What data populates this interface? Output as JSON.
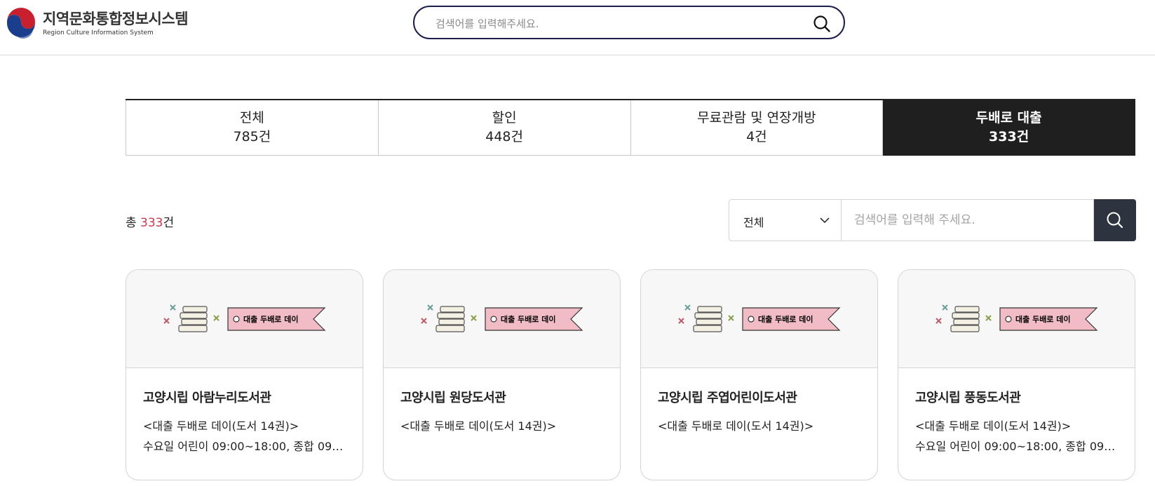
{
  "header": {
    "logo_title": "지역문화통합정보시스템",
    "logo_sub": "Region Culture Information System",
    "search_placeholder": "검색어를 입력해주세요."
  },
  "tabs": [
    {
      "label": "전체",
      "count": "785건",
      "active": false
    },
    {
      "label": "할인",
      "count": "448건",
      "active": false
    },
    {
      "label": "무료관람 및 연장개방",
      "count": "4건",
      "active": false
    },
    {
      "label": "두배로 대출",
      "count": "333건",
      "active": true
    }
  ],
  "results": {
    "prefix": "총 ",
    "count": "333",
    "suffix": "건"
  },
  "filter": {
    "selected": "전체",
    "placeholder": "검색어를 입력해 주세요."
  },
  "cards": [
    {
      "banner": "대출 두배로 데이",
      "title": "고양시립 아람누리도서관",
      "line1": "<대출 두배로 데이(도서 14권)>",
      "line2": "수요일 어린이 09:00~18:00, 종합 09:..."
    },
    {
      "banner": "대출 두배로 데이",
      "title": "고양시립 원당도서관",
      "line1": "<대출 두배로 데이(도서 14권)>",
      "line2": ""
    },
    {
      "banner": "대출 두배로 데이",
      "title": "고양시립 주엽어린이도서관",
      "line1": "<대출 두배로 데이(도서 14권)>",
      "line2": ""
    },
    {
      "banner": "대출 두배로 데이",
      "title": "고양시립 풍동도서관",
      "line1": "<대출 두배로 데이(도서 14권)>",
      "line2": "수요일 어린이 09:00~18:00, 종합 09:..."
    }
  ],
  "colors": {
    "accent_red": "#d6364a",
    "active_tab": "#1f1f1f",
    "search_border": "#1c1f4d",
    "search_button": "#2e3340",
    "banner_pink": "#f2bcc6"
  }
}
